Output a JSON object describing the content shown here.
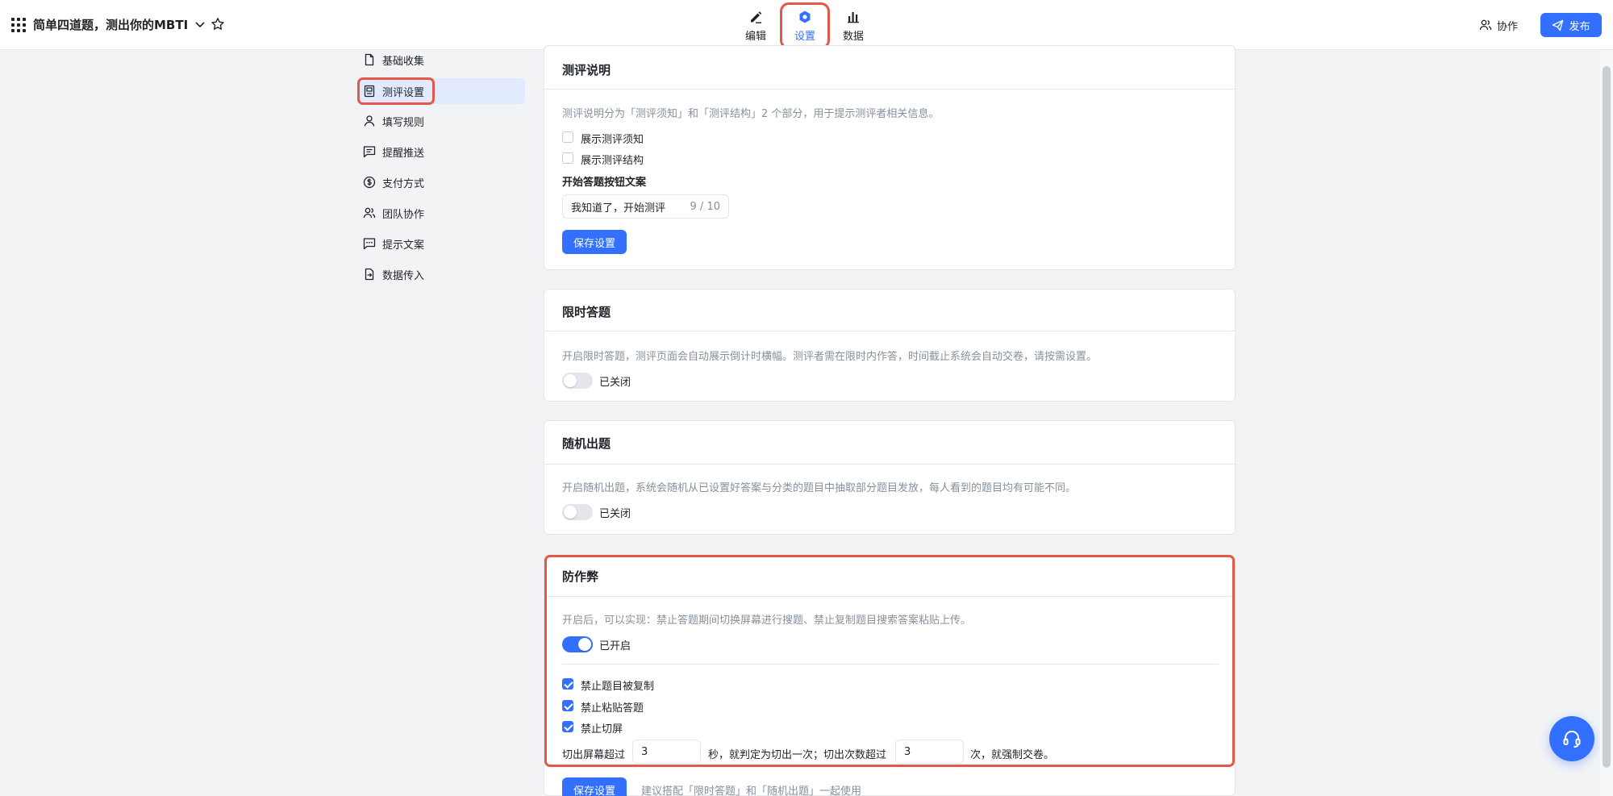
{
  "header": {
    "title": "简单四道题，测出你的MBTI",
    "tabs": [
      {
        "label": "编辑",
        "icon": "pen-icon"
      },
      {
        "label": "设置",
        "icon": "settings-hexagon-icon"
      },
      {
        "label": "数据",
        "icon": "bar-chart-icon"
      }
    ],
    "collab_label": "协作",
    "publish_label": "发布"
  },
  "sidebar": {
    "items": [
      {
        "label": "基础收集",
        "icon": "document-icon"
      },
      {
        "label": "测评设置",
        "icon": "assessment-icon",
        "active": true
      },
      {
        "label": "填写规则",
        "icon": "user-icon"
      },
      {
        "label": "提醒推送",
        "icon": "message-list-icon"
      },
      {
        "label": "支付方式",
        "icon": "dollar-circle-icon"
      },
      {
        "label": "团队协作",
        "icon": "team-icon"
      },
      {
        "label": "提示文案",
        "icon": "chat-bubble-icon"
      },
      {
        "label": "数据传入",
        "icon": "import-file-icon"
      }
    ]
  },
  "sections": {
    "intro": {
      "title": "测评说明",
      "desc": "测评说明分为「测评须知」和「测评结构」2 个部分，用于提示测评者相关信息。",
      "checkbox_notice": "展示测评须知",
      "checkbox_structure": "展示测评结构",
      "button_copy_label": "开始答题按钮文案",
      "button_copy_value": "我知道了，开始测评",
      "button_copy_count": "9 / 10",
      "save_label": "保存设置"
    },
    "timed": {
      "title": "限时答题",
      "desc": "开启限时答题，测评页面会自动展示倒计时横幅。测评者需在限时内作答，时间截止系统会自动交卷，请按需设置。",
      "switch_label": "已关闭"
    },
    "random": {
      "title": "随机出题",
      "desc": "开启随机出题，系统会随机从已设置好答案与分类的题目中抽取部分题目发放，每人看到的题目均有可能不同。",
      "switch_label": "已关闭"
    },
    "anticheat": {
      "title": "防作弊",
      "desc": "开启后，可以实现：禁止答题期间切换屏幕进行搜题、禁止复制题目搜索答案粘贴上传。",
      "switch_label": "已开启",
      "opt_copy": "禁止题目被复制",
      "opt_paste": "禁止粘贴答题",
      "opt_switch": "禁止切屏",
      "rule_prefix": "切出屏幕超过",
      "rule_seconds": "3",
      "rule_middle": "秒，就判定为切出一次；切出次数超过",
      "rule_times": "3",
      "rule_suffix": "次，就强制交卷。",
      "save_label": "保存设置",
      "tip": "建议搭配「限时答题」和「随机出题」一起使用"
    }
  },
  "colors": {
    "accent": "#3370ff",
    "highlight": "#e4574b"
  }
}
